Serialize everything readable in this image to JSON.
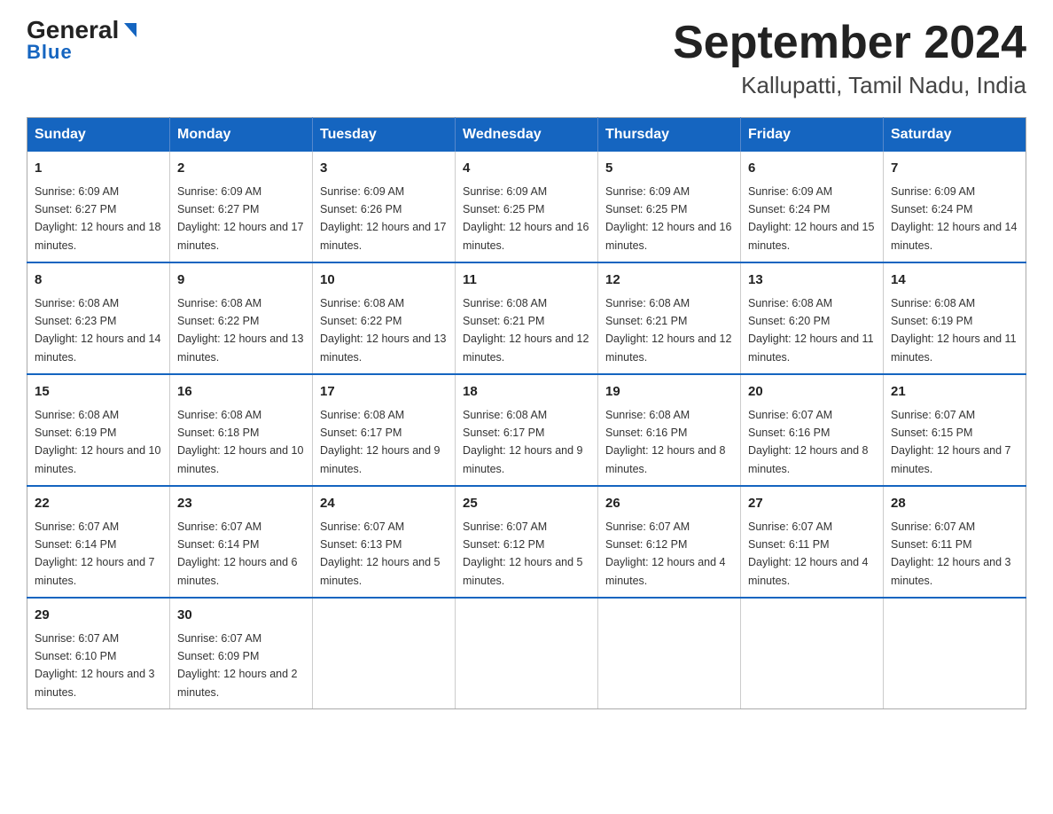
{
  "logo": {
    "general": "General",
    "blue": "Blue",
    "arrow_char": "▶"
  },
  "title": "September 2024",
  "subtitle": "Kallupatti, Tamil Nadu, India",
  "days_of_week": [
    "Sunday",
    "Monday",
    "Tuesday",
    "Wednesday",
    "Thursday",
    "Friday",
    "Saturday"
  ],
  "weeks": [
    [
      {
        "day": "1",
        "sunrise": "6:09 AM",
        "sunset": "6:27 PM",
        "daylight": "12 hours and 18 minutes."
      },
      {
        "day": "2",
        "sunrise": "6:09 AM",
        "sunset": "6:27 PM",
        "daylight": "12 hours and 17 minutes."
      },
      {
        "day": "3",
        "sunrise": "6:09 AM",
        "sunset": "6:26 PM",
        "daylight": "12 hours and 17 minutes."
      },
      {
        "day": "4",
        "sunrise": "6:09 AM",
        "sunset": "6:25 PM",
        "daylight": "12 hours and 16 minutes."
      },
      {
        "day": "5",
        "sunrise": "6:09 AM",
        "sunset": "6:25 PM",
        "daylight": "12 hours and 16 minutes."
      },
      {
        "day": "6",
        "sunrise": "6:09 AM",
        "sunset": "6:24 PM",
        "daylight": "12 hours and 15 minutes."
      },
      {
        "day": "7",
        "sunrise": "6:09 AM",
        "sunset": "6:24 PM",
        "daylight": "12 hours and 14 minutes."
      }
    ],
    [
      {
        "day": "8",
        "sunrise": "6:08 AM",
        "sunset": "6:23 PM",
        "daylight": "12 hours and 14 minutes."
      },
      {
        "day": "9",
        "sunrise": "6:08 AM",
        "sunset": "6:22 PM",
        "daylight": "12 hours and 13 minutes."
      },
      {
        "day": "10",
        "sunrise": "6:08 AM",
        "sunset": "6:22 PM",
        "daylight": "12 hours and 13 minutes."
      },
      {
        "day": "11",
        "sunrise": "6:08 AM",
        "sunset": "6:21 PM",
        "daylight": "12 hours and 12 minutes."
      },
      {
        "day": "12",
        "sunrise": "6:08 AM",
        "sunset": "6:21 PM",
        "daylight": "12 hours and 12 minutes."
      },
      {
        "day": "13",
        "sunrise": "6:08 AM",
        "sunset": "6:20 PM",
        "daylight": "12 hours and 11 minutes."
      },
      {
        "day": "14",
        "sunrise": "6:08 AM",
        "sunset": "6:19 PM",
        "daylight": "12 hours and 11 minutes."
      }
    ],
    [
      {
        "day": "15",
        "sunrise": "6:08 AM",
        "sunset": "6:19 PM",
        "daylight": "12 hours and 10 minutes."
      },
      {
        "day": "16",
        "sunrise": "6:08 AM",
        "sunset": "6:18 PM",
        "daylight": "12 hours and 10 minutes."
      },
      {
        "day": "17",
        "sunrise": "6:08 AM",
        "sunset": "6:17 PM",
        "daylight": "12 hours and 9 minutes."
      },
      {
        "day": "18",
        "sunrise": "6:08 AM",
        "sunset": "6:17 PM",
        "daylight": "12 hours and 9 minutes."
      },
      {
        "day": "19",
        "sunrise": "6:08 AM",
        "sunset": "6:16 PM",
        "daylight": "12 hours and 8 minutes."
      },
      {
        "day": "20",
        "sunrise": "6:07 AM",
        "sunset": "6:16 PM",
        "daylight": "12 hours and 8 minutes."
      },
      {
        "day": "21",
        "sunrise": "6:07 AM",
        "sunset": "6:15 PM",
        "daylight": "12 hours and 7 minutes."
      }
    ],
    [
      {
        "day": "22",
        "sunrise": "6:07 AM",
        "sunset": "6:14 PM",
        "daylight": "12 hours and 7 minutes."
      },
      {
        "day": "23",
        "sunrise": "6:07 AM",
        "sunset": "6:14 PM",
        "daylight": "12 hours and 6 minutes."
      },
      {
        "day": "24",
        "sunrise": "6:07 AM",
        "sunset": "6:13 PM",
        "daylight": "12 hours and 5 minutes."
      },
      {
        "day": "25",
        "sunrise": "6:07 AM",
        "sunset": "6:12 PM",
        "daylight": "12 hours and 5 minutes."
      },
      {
        "day": "26",
        "sunrise": "6:07 AM",
        "sunset": "6:12 PM",
        "daylight": "12 hours and 4 minutes."
      },
      {
        "day": "27",
        "sunrise": "6:07 AM",
        "sunset": "6:11 PM",
        "daylight": "12 hours and 4 minutes."
      },
      {
        "day": "28",
        "sunrise": "6:07 AM",
        "sunset": "6:11 PM",
        "daylight": "12 hours and 3 minutes."
      }
    ],
    [
      {
        "day": "29",
        "sunrise": "6:07 AM",
        "sunset": "6:10 PM",
        "daylight": "12 hours and 3 minutes."
      },
      {
        "day": "30",
        "sunrise": "6:07 AM",
        "sunset": "6:09 PM",
        "daylight": "12 hours and 2 minutes."
      },
      null,
      null,
      null,
      null,
      null
    ]
  ]
}
